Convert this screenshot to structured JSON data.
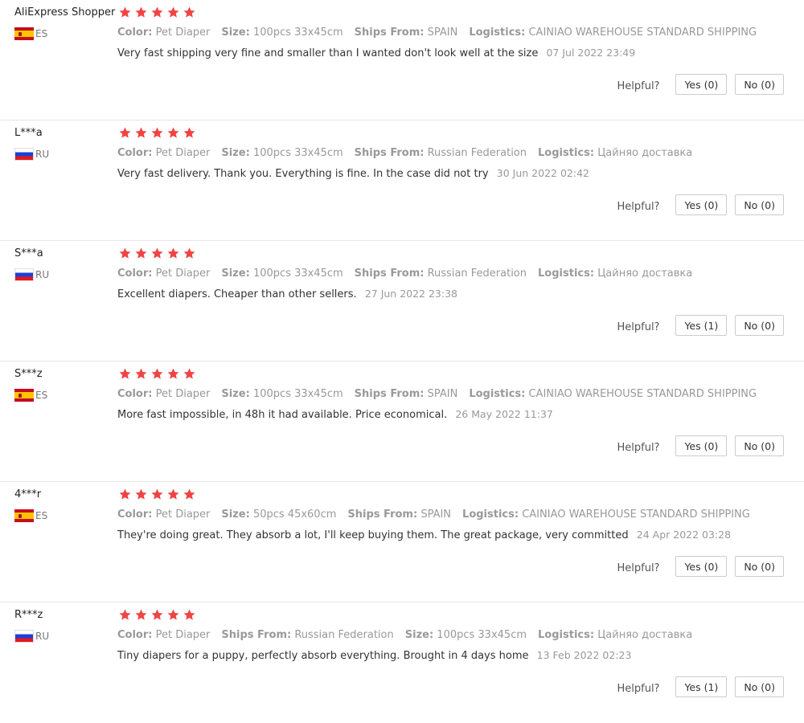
{
  "colors": {
    "star": "#f04444",
    "label": "#999999",
    "text": "#333333",
    "divider": "#e6e6e6"
  },
  "helpful_label": "Helpful?",
  "reviews": [
    {
      "user": "AliExpress Shopper",
      "country": "ES",
      "flag_icon": "spain-flag-icon",
      "stars": 5,
      "attributes": [
        {
          "key": "Color:",
          "value": "Pet Diaper"
        },
        {
          "key": "Size:",
          "value": "100pcs 33x45cm"
        },
        {
          "key": "Ships From:",
          "value": "SPAIN"
        },
        {
          "key": "Logistics:",
          "value": "CAINIAO WAREHOUSE STANDARD SHIPPING"
        }
      ],
      "comment": "Very fast shipping very fine and smaller than I wanted don't look well at the size",
      "date": "07 Jul 2022 23:49",
      "yes": "Yes (0)",
      "no": "No (0)"
    },
    {
      "user": "L***a",
      "country": "RU",
      "flag_icon": "russia-flag-icon",
      "stars": 5,
      "attributes": [
        {
          "key": "Color:",
          "value": "Pet Diaper"
        },
        {
          "key": "Size:",
          "value": "100pcs 33x45cm"
        },
        {
          "key": "Ships From:",
          "value": "Russian Federation"
        },
        {
          "key": "Logistics:",
          "value": "Цайняо доставка"
        }
      ],
      "comment": "Very fast delivery. Thank you. Everything is fine. In the case did not try",
      "date": "30 Jun 2022 02:42",
      "yes": "Yes (0)",
      "no": "No (0)"
    },
    {
      "user": "S***a",
      "country": "RU",
      "flag_icon": "russia-flag-icon",
      "stars": 5,
      "attributes": [
        {
          "key": "Color:",
          "value": "Pet Diaper"
        },
        {
          "key": "Size:",
          "value": "100pcs 33x45cm"
        },
        {
          "key": "Ships From:",
          "value": "Russian Federation"
        },
        {
          "key": "Logistics:",
          "value": "Цайняо доставка"
        }
      ],
      "comment": "Excellent diapers. Cheaper than other sellers.",
      "date": "27 Jun 2022 23:38",
      "yes": "Yes (1)",
      "no": "No (0)"
    },
    {
      "user": "S***z",
      "country": "ES",
      "flag_icon": "spain-flag-icon",
      "stars": 5,
      "attributes": [
        {
          "key": "Color:",
          "value": "Pet Diaper"
        },
        {
          "key": "Size:",
          "value": "100pcs 33x45cm"
        },
        {
          "key": "Ships From:",
          "value": "SPAIN"
        },
        {
          "key": "Logistics:",
          "value": "CAINIAO WAREHOUSE STANDARD SHIPPING"
        }
      ],
      "comment": "More fast impossible, in 48h it had available. Price economical.",
      "date": "26 May 2022 11:37",
      "yes": "Yes (0)",
      "no": "No (0)"
    },
    {
      "user": "4***r",
      "country": "ES",
      "flag_icon": "spain-flag-icon",
      "stars": 5,
      "attributes": [
        {
          "key": "Color:",
          "value": "Pet Diaper"
        },
        {
          "key": "Size:",
          "value": "50pcs 45x60cm"
        },
        {
          "key": "Ships From:",
          "value": "SPAIN"
        },
        {
          "key": "Logistics:",
          "value": "CAINIAO WAREHOUSE STANDARD SHIPPING"
        }
      ],
      "comment": "They're doing great. They absorb a lot, I'll keep buying them. The great package, very committed",
      "date": "24 Apr 2022 03:28",
      "yes": "Yes (0)",
      "no": "No (0)"
    },
    {
      "user": "R***z",
      "country": "RU",
      "flag_icon": "russia-flag-icon",
      "stars": 5,
      "attributes": [
        {
          "key": "Color:",
          "value": "Pet Diaper"
        },
        {
          "key": "Ships From:",
          "value": "Russian Federation"
        },
        {
          "key": "Size:",
          "value": "100pcs 33x45cm"
        },
        {
          "key": "Logistics:",
          "value": "Цайняо доставка"
        }
      ],
      "comment": "Tiny diapers for a puppy, perfectly absorb everything. Brought in 4 days home",
      "date": "13 Feb 2022 02:23",
      "yes": "Yes (1)",
      "no": "No (0)"
    }
  ]
}
